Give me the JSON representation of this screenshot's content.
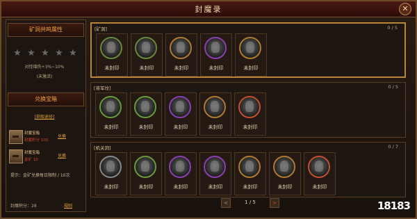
{
  "window": {
    "title": "封魔录"
  },
  "left": {
    "section1_title": "矿洞共鸣属性",
    "stars_count": 5,
    "bonus_text": "对怪增伤+3%~10%",
    "status_text": "(未激活)",
    "section2_title": "兑换宝箱",
    "get_link": "[获取途径]",
    "chests": [
      {
        "name": "封魔宝箱",
        "cost": "封魔积分 100",
        "button": "兑换"
      },
      {
        "name": "封魔宝箱",
        "cost": "金矿 10",
        "button": "兑换"
      }
    ],
    "tip": "提示：金矿兑换每日限制 / 10次",
    "points_label": "封魔积分：28",
    "rank_link": "规则"
  },
  "groups": [
    {
      "title": "[矿洞]",
      "count": "0 / 5",
      "slots": [
        {
          "label": "未封印",
          "color": "#6a8a3a"
        },
        {
          "label": "未封印",
          "color": "#6a8a3a"
        },
        {
          "label": "未封印",
          "color": "#b07a30"
        },
        {
          "label": "未封印",
          "color": "#8a40b0"
        },
        {
          "label": "未封印",
          "color": "#b07a30"
        }
      ]
    },
    {
      "title": "[将军坟]",
      "count": "0 / 5",
      "slots": [
        {
          "label": "未封印",
          "color": "#6a9a3a"
        },
        {
          "label": "未封印",
          "color": "#6a9a3a"
        },
        {
          "label": "未封印",
          "color": "#8a40b0"
        },
        {
          "label": "未封印",
          "color": "#b07a30"
        },
        {
          "label": "未封印",
          "color": "#c05030"
        }
      ]
    },
    {
      "title": "[机关洞]",
      "count": "0 / 7",
      "slots": [
        {
          "label": "未封印",
          "color": "#888888"
        },
        {
          "label": "未封印",
          "color": "#6a9a3a"
        },
        {
          "label": "未封印",
          "color": "#8a40b0"
        },
        {
          "label": "未封印",
          "color": "#8a40b0"
        },
        {
          "label": "未封印",
          "color": "#b07a30"
        },
        {
          "label": "未封印",
          "color": "#b07a30"
        },
        {
          "label": "未封印",
          "color": "#c05030"
        }
      ]
    }
  ],
  "pager": {
    "prev": "<",
    "text": "1 / 5",
    "next": ">"
  },
  "watermark": {
    "text": "18183"
  }
}
